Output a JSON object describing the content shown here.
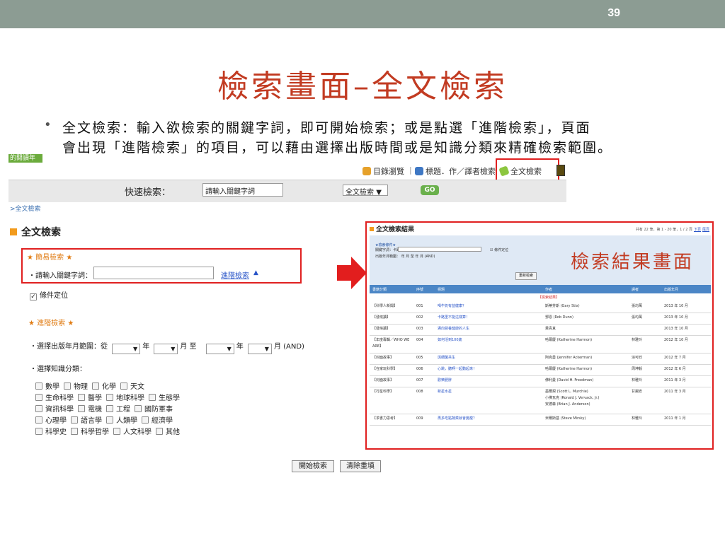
{
  "slide": {
    "page_number": "39",
    "title": "檢索畫面–全文檢索",
    "bullet_lines": [
      "全文檢索：輸入欲檢索的關鍵字詞，即可開始檢索；或是點選「進階檢索」，頁面",
      "會出現「進階檢索」的項目，可以藉由選擇出版時間或是知識分類來精確檢索範圍。"
    ],
    "overlay_label": "檢索結果畫面"
  },
  "site": {
    "logo_text": "的閱讀年",
    "nav": [
      {
        "label": "目錄瀏覽",
        "icon": "catalog-icon"
      },
      {
        "label": "標題．作／譯者檢索",
        "icon": "title-search-icon"
      },
      {
        "label": "全文檢索",
        "icon": "fulltext-icon"
      }
    ],
    "quick_search": {
      "label": "快速檢索：",
      "placeholder": "請輸入關鍵字詞",
      "mode": "全文檢索",
      "go_label": "GO"
    },
    "breadcrumb": ">全文檢索"
  },
  "form": {
    "title": "全文檢索",
    "simple_title": "★ 簡易檢索 ★",
    "keyword_label": "・請輸入關鍵字詞：",
    "advanced_link": "進階檢索",
    "condition_label": "條件定位",
    "advanced_title": "★ 進階檢索 ★",
    "date_row": {
      "label": "・選擇出版年月範圍：從",
      "year": "年",
      "month_to": "月 至",
      "month_and": "月 (AND)"
    },
    "category_label": "・選擇知識分類：",
    "categories": [
      [
        "數學",
        "物理",
        "化學",
        "天文"
      ],
      [
        "生命科學",
        "醫學",
        "地球科學",
        "生態學"
      ],
      [
        "資訊科學",
        "電機",
        "工程",
        "國防軍事"
      ],
      [
        "心理學",
        "語言學",
        "人類學",
        "經濟學"
      ],
      [
        "科學史",
        "科學哲學",
        "人文科學",
        "其他"
      ]
    ],
    "start_button": "開始檢索",
    "clear_button": "清除重填"
  },
  "results": {
    "title": "全文檢索結果",
    "count_text": "共有 22 筆，第 1 - 20 筆，1 / 2 頁",
    "next_link": "下頁",
    "last_link": "尾頁",
    "criteria_title": "★檢索條件★",
    "keyword_text": "關鍵字詞：卡路里",
    "condition_text": "條件定位",
    "date_text": "出版年月範圍：     年      月 至      年      月 (AND)",
    "requery_label": "重新檢索",
    "headers": [
      "書籍分類",
      "序號",
      "標題",
      "作者",
      "譯者",
      "出版年月"
    ],
    "subheader": "【檢索結果】",
    "rows": [
      {
        "category": "【科學人新聞】",
        "no": "001",
        "title": "喝牛奶有益健康？",
        "author": "斯蒂芬斯 (Gary Stix)",
        "translator": "張均萬",
        "date": "2013 年 10 月"
      },
      {
        "category": "【發燒讀】",
        "no": "002",
        "title": "卡路里不能這樣算！",
        "author": "鄧恩 (Rob Dunn)",
        "translator": "張均萬",
        "date": "2013 年 10 月"
      },
      {
        "category": "【發燒讀】",
        "no": "003",
        "title": "邁向營養健康的人生",
        "author": "黃青真",
        "translator": "",
        "date": "2013 年 10 月"
      },
      {
        "category": "【年度專輯／WHO WE ARE】",
        "no": "004",
        "title": "如何活到100歲",
        "author": "哈爾慶 (Katherine Harmon)",
        "translator": "林雅玲",
        "date": "2012 年 10 月"
      },
      {
        "category": "【封面故事】",
        "no": "005",
        "title": "與細菌共生",
        "author": "阿克曼 (Jennifer Ackerman)",
        "translator": "涂可欣",
        "date": "2012 年 7 月"
      },
      {
        "category": "【在家玩科學】",
        "no": "006",
        "title": "心跳，聽啊一起動起來！",
        "author": "哈爾慶 (Katherine Harmon)",
        "translator": "周坤毅",
        "date": "2012 年 6 月"
      },
      {
        "category": "【封面故事】",
        "no": "007",
        "title": "歡樂肥胖",
        "author": "佛利曼 (David H. Freedman)",
        "translator": "林雅玲",
        "date": "2011 年 3 月"
      },
      {
        "category": "【行星科學】",
        "no": "008",
        "title": "新星水星",
        "author": "墨爾契 (Scott L. Murchie)\n小佛瓦克 (Ronald J. Vervack, Jr.)\n安德森 (Brian J. Anderson)",
        "translator": "甘錫安",
        "date": "2011 年 3 月"
      },
      {
        "category": "【求書力思考】",
        "no": "009",
        "title": "再多吃點蔬菜就會變瘦？",
        "author": "米爾斯基 (Steve Mirsky)",
        "translator": "林雅玲",
        "date": "2011 年 1 月"
      }
    ]
  },
  "colors": {
    "topbar": "#8c9c93",
    "title_red": "#c23b22",
    "highlight_red": "#e02020",
    "accent_orange": "#f29b1d",
    "link_blue": "#2a55c8",
    "table_head_blue": "#4b86c6",
    "go_green": "#6ab04c"
  }
}
